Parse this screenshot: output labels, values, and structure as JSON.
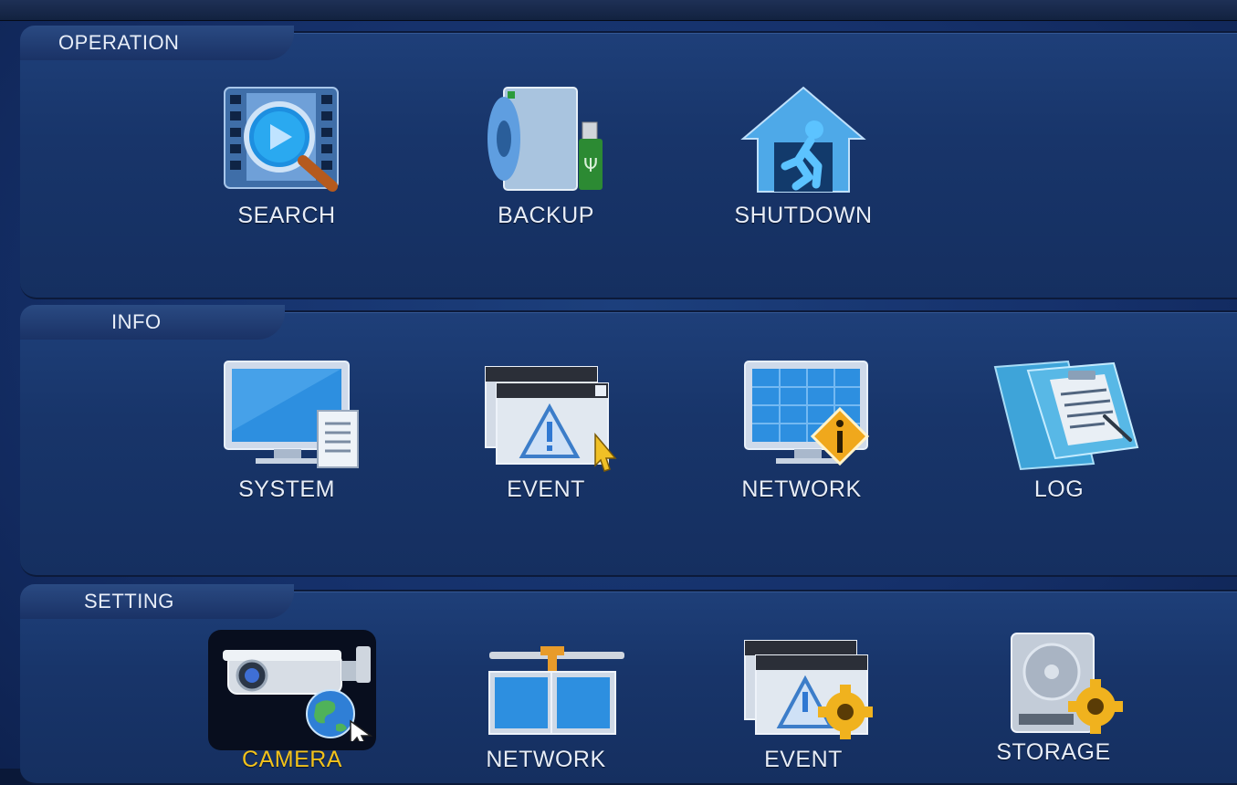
{
  "sections": {
    "operation": {
      "title": "OPERATION",
      "items": [
        {
          "label": "SEARCH",
          "icon": "search-video-icon"
        },
        {
          "label": "BACKUP",
          "icon": "backup-usb-icon"
        },
        {
          "label": "SHUTDOWN",
          "icon": "shutdown-exit-icon"
        }
      ]
    },
    "info": {
      "title": "INFO",
      "items": [
        {
          "label": "SYSTEM",
          "icon": "system-monitor-icon"
        },
        {
          "label": "EVENT",
          "icon": "event-warning-icon"
        },
        {
          "label": "NETWORK",
          "icon": "network-info-icon"
        },
        {
          "label": "LOG",
          "icon": "log-clipboard-icon"
        }
      ]
    },
    "setting": {
      "title": "SETTING",
      "items": [
        {
          "label": "CAMERA",
          "icon": "camera-globe-icon",
          "selected": true
        },
        {
          "label": "NETWORK",
          "icon": "network-setting-icon"
        },
        {
          "label": "EVENT",
          "icon": "event-gear-icon"
        },
        {
          "label": "STORAGE",
          "icon": "storage-gear-icon"
        }
      ]
    }
  },
  "colors": {
    "background": "#15306a",
    "label": "#e7edf8",
    "selected_label": "#f2c21b"
  }
}
